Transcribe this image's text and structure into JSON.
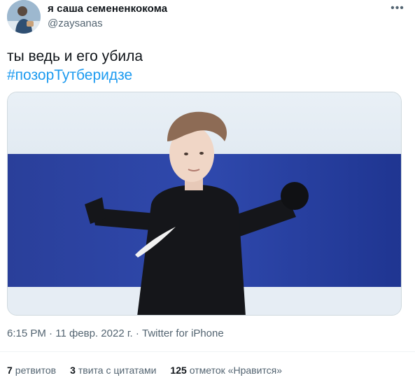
{
  "author": {
    "display_name": "я саша семененкокома",
    "handle": "@zaysanas"
  },
  "more_icon": "more-horizontal-icon",
  "tweet": {
    "text": "ты ведь и его убила",
    "hashtag": "#позорТутберидзе"
  },
  "meta": {
    "time": "6:15 PM",
    "separator1": "·",
    "date": "11 февр. 2022 г.",
    "separator2": "·",
    "source": "Twitter for iPhone"
  },
  "stats": {
    "retweets_count": "7",
    "retweets_label": "ретвитов",
    "quotes_count": "3",
    "quotes_label": "твита с цитатами",
    "likes_count": "125",
    "likes_label": "отметок «Нравится»"
  },
  "colors": {
    "text": "#0f1419",
    "secondary": "#536471",
    "link": "#1d9bf0",
    "border": "#cfd9de"
  }
}
